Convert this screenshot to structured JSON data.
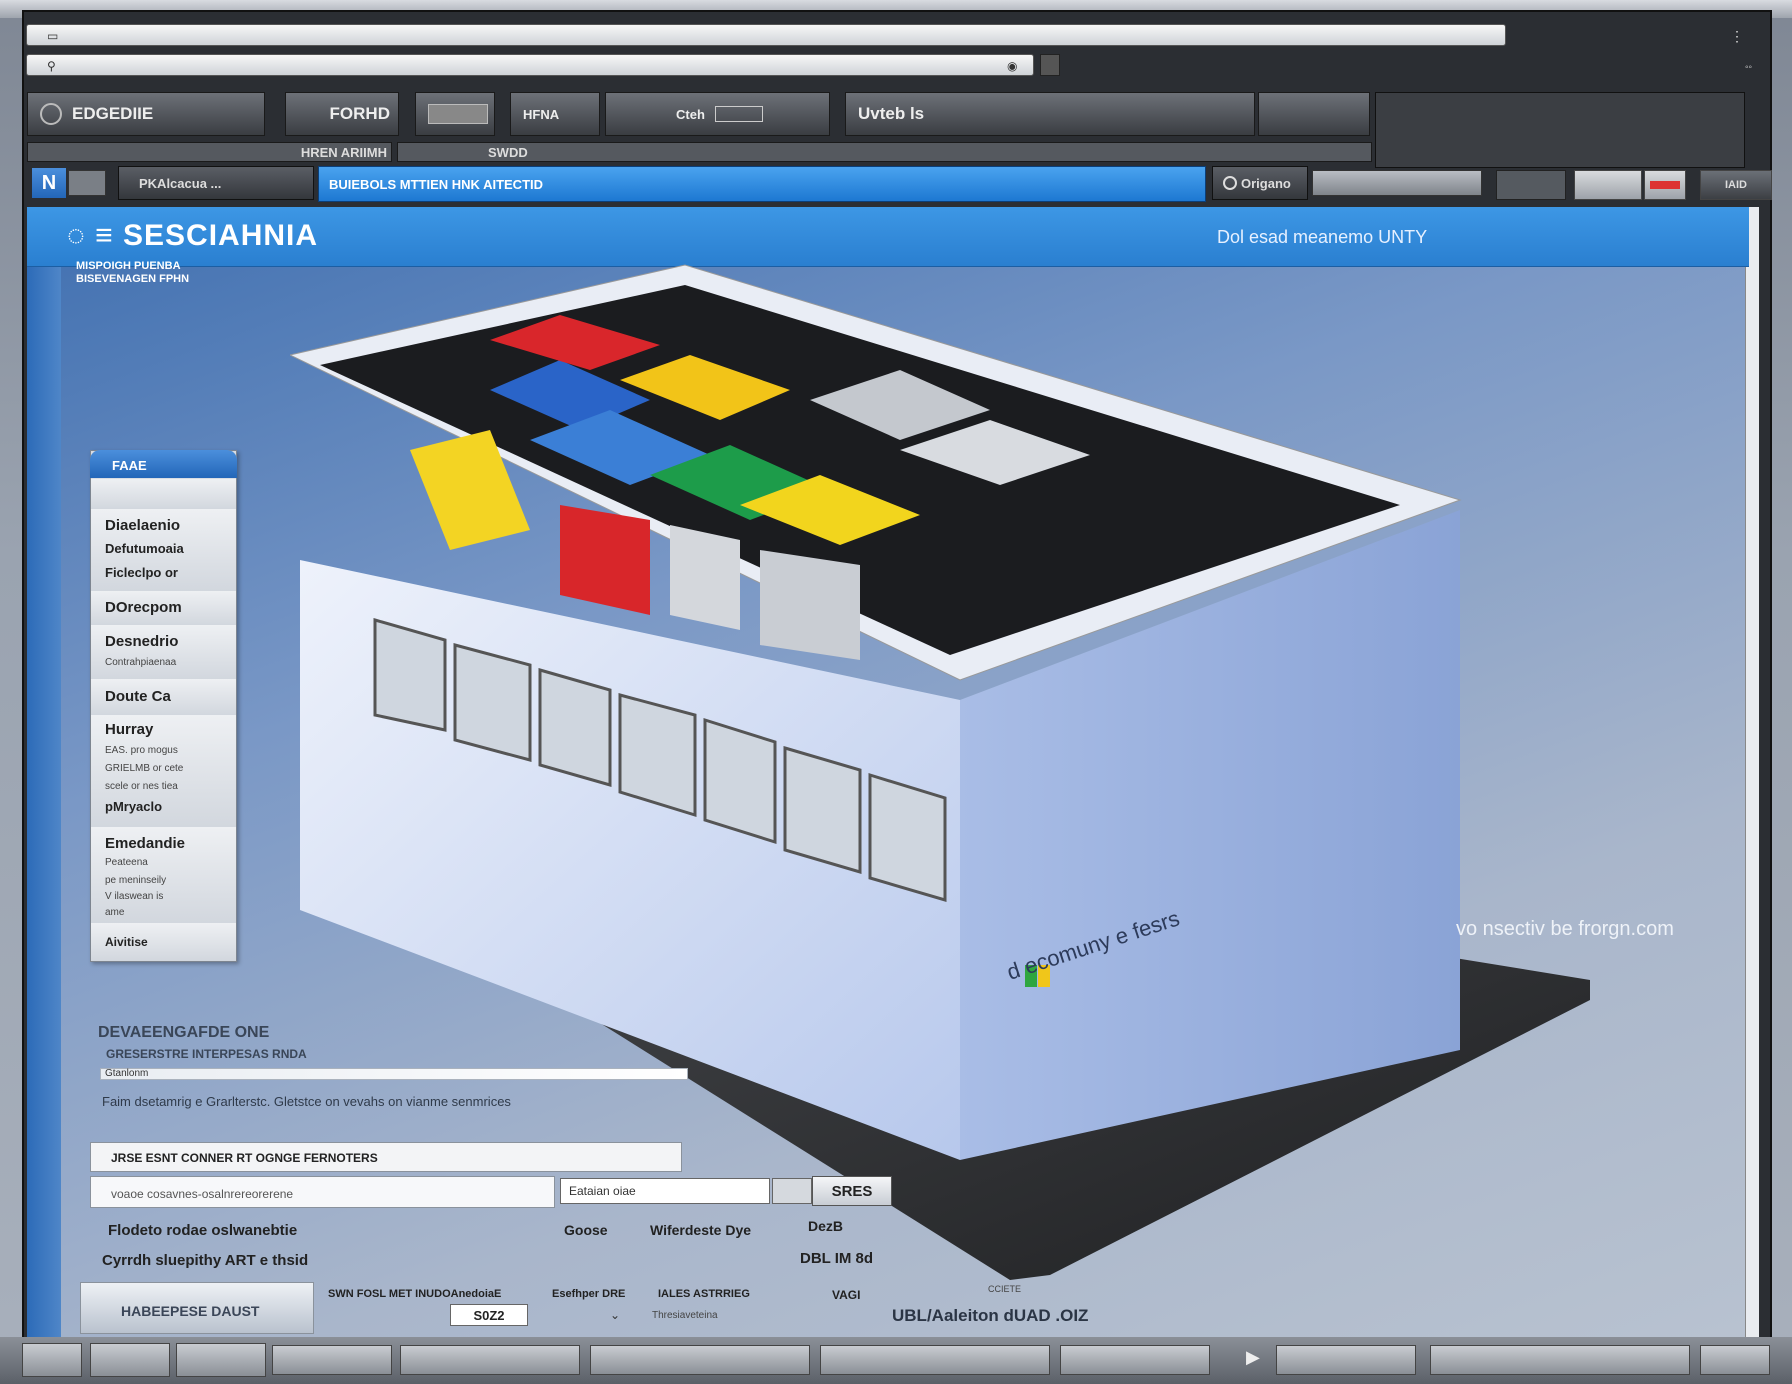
{
  "window": {
    "title": "",
    "address_line1": "",
    "address_line2": ""
  },
  "toolbar": {
    "buttons": [
      {
        "label": "EDGEDIIE"
      },
      {
        "label": "FORHD"
      },
      {
        "label": ""
      },
      {
        "label": "HFNA"
      },
      {
        "label": "Cteh"
      },
      {
        "label": "Uvteb ls"
      }
    ],
    "sub": [
      {
        "label": "HREN ARIIMH"
      },
      {
        "label": "SWDD"
      }
    ]
  },
  "nav": {
    "n_badge": "N",
    "item1": "PKAlcacua ...",
    "blue_item": "BUIEBOLS MTTIEN HNK AITECTID",
    "search": "Origano",
    "mini_right": "IAID"
  },
  "header": {
    "logo": "SESCIAHNIA",
    "right_text": "Dol esad meanemo UNTY",
    "sub1": "MISPOIGH PUENBA",
    "sub2": "BISEVENAGEN FPHN"
  },
  "menu": {
    "tab": "FAAE",
    "items": [
      {
        "heading": "Diaelaenio",
        "lines": [
          "Defutumoaia",
          "Ficleclpo or"
        ]
      },
      {
        "heading": "DOrecpom",
        "lines": []
      },
      {
        "heading": "Desnedrio",
        "lines": [
          "Contrahpiaenaa"
        ]
      },
      {
        "heading": "Doute Ca",
        "lines": []
      },
      {
        "heading": "Hurray",
        "lines": [
          "EAS. pro mogus",
          "GRIELMB or cete",
          "scele or nes tiea",
          "pMryaclo"
        ]
      },
      {
        "heading": "Emedandie",
        "lines": [
          "Peateena",
          "pe meninseily",
          "V ilaswean is",
          "ame"
        ]
      },
      {
        "heading": "Aivitise",
        "lines": []
      }
    ]
  },
  "device": {
    "side_text": "d   ecomuny e fesrs"
  },
  "watermark": "vo nsectiv be frorgn.com",
  "form": {
    "heading": "DEVAEENGAFDE ONE",
    "subheading": "GRESERSTRE INTERPESAS RNDA",
    "bar_label": "Gtanlonm",
    "description": "Faim dsetamrig e Grarlterstc. Gletstce on vevahs on vianme senmrices",
    "row_label": "JRSE ESNT CONNER RT OGNGE FERNOTERS",
    "input_placeholder": "voaoe cosavnes-osalnrereorerene",
    "select_value": "Eataian oiae",
    "button_label": "SRES",
    "line1_left": "Flodeto rodae oslwanebtie",
    "line1_mid": "Goose",
    "line1_right": "Wiferdeste Dye",
    "line1_val": "DezB",
    "line2_left": "Cyrrdh sluepithy ART e thsid",
    "line2_val": "DBL IM 8d",
    "bottom_left": "HABEEPESE DAUST",
    "bottom_c1": "SWN FOSL MET INUDOAnedoiaE",
    "bottom_c1_val": "S0Z2",
    "bottom_c2": "Esefhper DRE",
    "bottom_c3": "IALES ASTRRIEG",
    "bottom_c3_sub": "Thresiaveteina",
    "bottom_c4": "VAGI",
    "bottom_c5_top": "CCIETE",
    "bottom_c5": "UBL/Aaleiton dUAD .OIZ"
  }
}
